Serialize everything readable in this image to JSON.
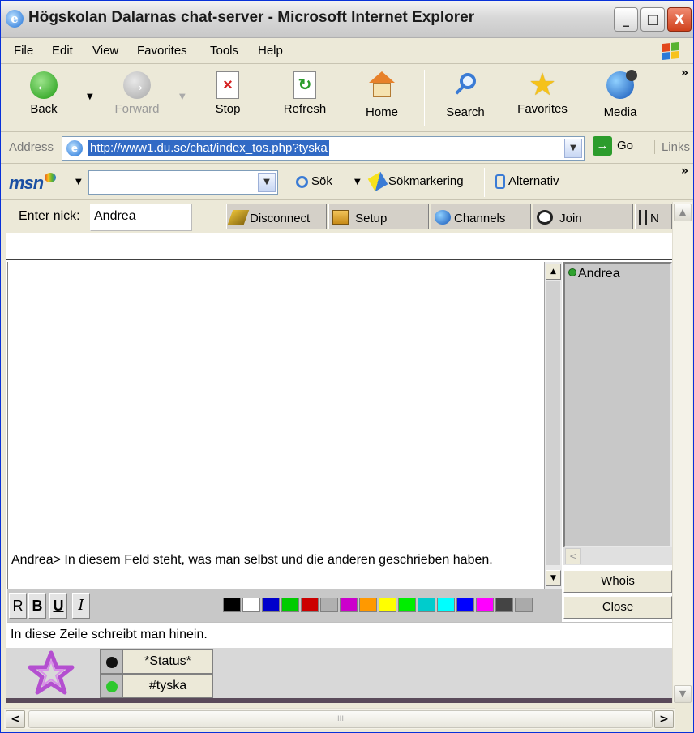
{
  "window": {
    "title": "Högskolan Dalarnas chat-server - Microsoft Internet Explorer",
    "controls": {
      "minimize": "_",
      "maximize": "□",
      "close": "X"
    }
  },
  "menu": {
    "items": [
      "File",
      "Edit",
      "View",
      "Favorites",
      "Tools",
      "Help"
    ]
  },
  "toolbar": {
    "back": "Back",
    "forward": "Forward",
    "stop": "Stop",
    "refresh": "Refresh",
    "home": "Home",
    "search": "Search",
    "favorites": "Favorites",
    "media": "Media",
    "more": "»"
  },
  "address": {
    "label": "Address",
    "url": "http://www1.du.se/chat/index_tos.php?tyska",
    "go": "Go",
    "links": "Links"
  },
  "msn": {
    "logo": "msn",
    "search_value": "",
    "sok": "Sök",
    "highlight": "Sökmarkering",
    "options": "Alternativ",
    "more": "»"
  },
  "chat": {
    "nick_label": "Enter nick:",
    "nick_value": "Andrea",
    "buttons": {
      "disconnect": "Disconnect",
      "setup": "Setup",
      "channels": "Channels",
      "join": "Join",
      "next": "N"
    },
    "topic": "",
    "messages": [
      "Andrea> In diesem Feld steht, was man selbst und die anderen geschrieben haben."
    ],
    "users": [
      "Andrea"
    ],
    "whois": "Whois",
    "close": "Close",
    "format": {
      "regular": "R",
      "bold": "B",
      "underline": "U",
      "italic": "I"
    },
    "colors": [
      "#000000",
      "#ffffff",
      "#0000cc",
      "#00cc00",
      "#cc0000",
      "#b0b0b0",
      "#cc00cc",
      "#ff9900",
      "#ffff00",
      "#00ee00",
      "#00cccc",
      "#00ffff",
      "#0000ff",
      "#ff00ff",
      "#444444",
      "#aaaaaa"
    ],
    "input_value": "In diese Zeile schreibt man hinein.",
    "tabs": [
      {
        "label": "*Status*",
        "indicator": "black"
      },
      {
        "label": "#tyska",
        "indicator": "green"
      }
    ]
  },
  "hscroll": {
    "grip": "III"
  }
}
